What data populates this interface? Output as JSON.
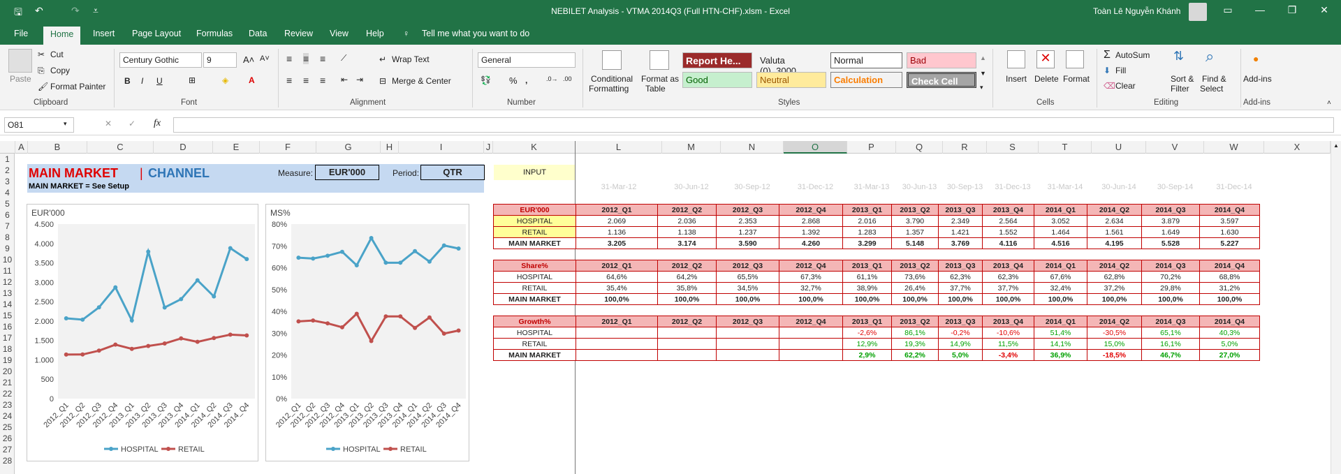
{
  "title_bar": {
    "title": "NEBILET Analysis - VTMA 2014Q3 (Full HTN-CHF).xlsm  -  Excel",
    "user": "Toàn  Lê Nguyễn Khánh"
  },
  "tabs": [
    "File",
    "Home",
    "Insert",
    "Page Layout",
    "Formulas",
    "Data",
    "Review",
    "View",
    "Help"
  ],
  "tell_me": "Tell me what you want to do",
  "ribbon": {
    "clipboard": {
      "paste": "Paste",
      "cut": "Cut",
      "copy": "Copy",
      "format_painter": "Format Painter",
      "group": "Clipboard"
    },
    "font": {
      "name": "Century Gothic",
      "size": "9",
      "group": "Font"
    },
    "alignment": {
      "wrap": "Wrap Text",
      "merge": "Merge & Center",
      "group": "Alignment"
    },
    "number": {
      "format": "General",
      "group": "Number"
    },
    "styles": {
      "cond1": "Conditional",
      "cond2": "Formatting",
      "fmt1": "Format as",
      "fmt2": "Table",
      "cells": [
        "Report He...",
        "Valuta (0)_3000",
        "Normal",
        "Bad",
        "Good",
        "Neutral",
        "Calculation",
        "Check Cell"
      ],
      "group": "Styles"
    },
    "cells": {
      "insert": "Insert",
      "delete": "Delete",
      "format": "Format",
      "group": "Cells"
    },
    "editing": {
      "autosum": "AutoSum",
      "fill": "Fill",
      "clear": "Clear",
      "sort1": "Sort &",
      "sort2": "Filter",
      "find1": "Find &",
      "find2": "Select",
      "group": "Editing"
    },
    "addins": {
      "label": "Add-ins",
      "group": "Add-ins"
    }
  },
  "name_box": "O81",
  "columns": [
    "A",
    "B",
    "C",
    "D",
    "E",
    "F",
    "G",
    "H",
    "I",
    "J",
    "K",
    "L",
    "M",
    "N",
    "O",
    "P",
    "Q",
    "R",
    "S",
    "T",
    "U",
    "V",
    "W",
    "X"
  ],
  "rows": [
    "1",
    "2",
    "3",
    "4",
    "5",
    "6",
    "7",
    "8",
    "9",
    "10",
    "11",
    "12",
    "13",
    "14",
    "15",
    "16",
    "17",
    "18",
    "19",
    "20",
    "21",
    "22",
    "23",
    "24",
    "25",
    "26",
    "27",
    "28"
  ],
  "sheet": {
    "title_main": "MAIN MARKET",
    "title_sep": "|",
    "title_channel": "CHANNEL",
    "subtitle": "MAIN MARKET = See Setup",
    "measure_label": "Measure:",
    "measure_value": "EUR'000",
    "period_label": "Period:",
    "period_value": "QTR",
    "input_label": "INPUT",
    "dates": [
      "31-Mar-12",
      "30-Jun-12",
      "30-Sep-12",
      "31-Dec-12",
      "31-Mar-13",
      "30-Jun-13",
      "30-Sep-13",
      "31-Dec-13",
      "31-Mar-14",
      "30-Jun-14",
      "30-Sep-14",
      "31-Dec-14"
    ]
  },
  "tables": {
    "periods": [
      "2012_Q1",
      "2012_Q2",
      "2012_Q3",
      "2012_Q4",
      "2013_Q1",
      "2013_Q2",
      "2013_Q3",
      "2013_Q4",
      "2014_Q1",
      "2014_Q2",
      "2014_Q3",
      "2014_Q4"
    ],
    "value_title": "EUR'000",
    "value_rows": [
      {
        "label": "HOSPITAL",
        "values": [
          "2.069",
          "2.036",
          "2.353",
          "2.868",
          "2.016",
          "3.790",
          "2.349",
          "2.564",
          "3.052",
          "2.634",
          "3.879",
          "3.597"
        ]
      },
      {
        "label": "RETAIL",
        "values": [
          "1.136",
          "1.138",
          "1.237",
          "1.392",
          "1.283",
          "1.357",
          "1.421",
          "1.552",
          "1.464",
          "1.561",
          "1.649",
          "1.630"
        ]
      },
      {
        "label": "MAIN MARKET",
        "values": [
          "3.205",
          "3.174",
          "3.590",
          "4.260",
          "3.299",
          "5.148",
          "3.769",
          "4.116",
          "4.516",
          "4.195",
          "5.528",
          "5.227"
        ]
      }
    ],
    "share_title": "Share%",
    "share_rows": [
      {
        "label": "HOSPITAL",
        "values": [
          "64,6%",
          "64,2%",
          "65,5%",
          "67,3%",
          "61,1%",
          "73,6%",
          "62,3%",
          "62,3%",
          "67,6%",
          "62,8%",
          "70,2%",
          "68,8%"
        ]
      },
      {
        "label": "RETAIL",
        "values": [
          "35,4%",
          "35,8%",
          "34,5%",
          "32,7%",
          "38,9%",
          "26,4%",
          "37,7%",
          "37,7%",
          "32,4%",
          "37,2%",
          "29,8%",
          "31,2%"
        ]
      },
      {
        "label": "MAIN MARKET",
        "values": [
          "100,0%",
          "100,0%",
          "100,0%",
          "100,0%",
          "100,0%",
          "100,0%",
          "100,0%",
          "100,0%",
          "100,0%",
          "100,0%",
          "100,0%",
          "100,0%"
        ]
      }
    ],
    "growth_title": "Growth%",
    "growth_rows": [
      {
        "label": "HOSPITAL",
        "values": [
          "",
          "",
          "",
          "",
          "-2,6%",
          "86,1%",
          "-0,2%",
          "-10,6%",
          "51,4%",
          "-30,5%",
          "65,1%",
          "40,3%"
        ]
      },
      {
        "label": "RETAIL",
        "values": [
          "",
          "",
          "",
          "",
          "12,9%",
          "19,3%",
          "14,9%",
          "11,5%",
          "14,1%",
          "15,0%",
          "16,1%",
          "5,0%"
        ]
      },
      {
        "label": "MAIN MARKET",
        "values": [
          "",
          "",
          "",
          "",
          "2,9%",
          "62,2%",
          "5,0%",
          "-3,4%",
          "36,9%",
          "-18,5%",
          "46,7%",
          "27,0%"
        ]
      }
    ]
  },
  "chart_data": [
    {
      "type": "line",
      "ylabel": "EUR'000",
      "ylim": [
        0,
        4500
      ],
      "yticks": [
        "0",
        "500",
        "1.000",
        "1.500",
        "2.000",
        "2.500",
        "3.000",
        "3.500",
        "4.000",
        "4.500"
      ],
      "categories": [
        "2012_Q1",
        "2012_Q2",
        "2012_Q3",
        "2012_Q4",
        "2013_Q1",
        "2013_Q2",
        "2013_Q3",
        "2013_Q4",
        "2014_Q1",
        "2014_Q2",
        "2014_Q3",
        "2014_Q4"
      ],
      "series": [
        {
          "name": "HOSPITAL",
          "color": "#4aa3c8",
          "values": [
            2069,
            2036,
            2353,
            2868,
            2016,
            3790,
            2349,
            2564,
            3052,
            2634,
            3879,
            3597
          ]
        },
        {
          "name": "RETAIL",
          "color": "#c0504d",
          "values": [
            1136,
            1138,
            1237,
            1392,
            1283,
            1357,
            1421,
            1552,
            1464,
            1561,
            1649,
            1630
          ]
        }
      ],
      "legend": "bottom"
    },
    {
      "type": "line",
      "ylabel": "MS%",
      "ylim": [
        0,
        80
      ],
      "yticks": [
        "0%",
        "10%",
        "20%",
        "30%",
        "40%",
        "50%",
        "60%",
        "70%",
        "80%"
      ],
      "categories": [
        "2012_Q1",
        "2012_Q2",
        "2012_Q3",
        "2012_Q4",
        "2013_Q1",
        "2013_Q2",
        "2013_Q3",
        "2013_Q4",
        "2014_Q1",
        "2014_Q2",
        "2014_Q3",
        "2014_Q4"
      ],
      "series": [
        {
          "name": "HOSPITAL",
          "color": "#4aa3c8",
          "values": [
            64.6,
            64.2,
            65.5,
            67.3,
            61.1,
            73.6,
            62.3,
            62.3,
            67.6,
            62.8,
            70.2,
            68.8
          ]
        },
        {
          "name": "RETAIL",
          "color": "#c0504d",
          "values": [
            35.4,
            35.8,
            34.5,
            32.7,
            38.9,
            26.4,
            37.7,
            37.7,
            32.4,
            37.2,
            29.8,
            31.2
          ]
        }
      ],
      "legend": "bottom"
    }
  ]
}
